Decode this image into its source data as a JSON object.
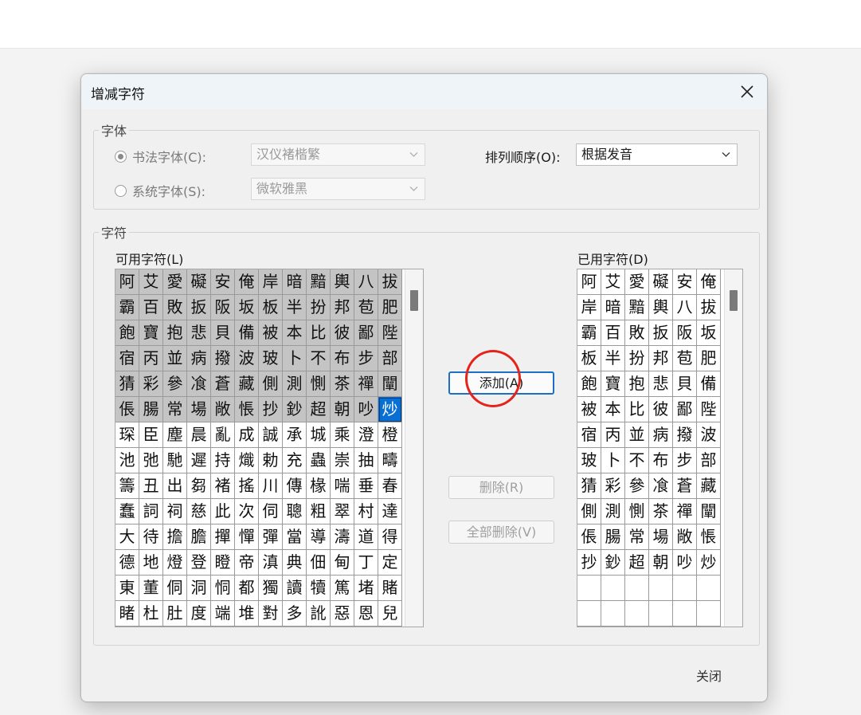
{
  "dialog": {
    "title": "增减字符",
    "font_group": {
      "legend": "字体",
      "calligraphy_radio": "书法字体(C):",
      "calligraphy_value": "汉仪褚楷繁",
      "system_radio": "系统字体(S):",
      "system_value": "微软雅黑",
      "sort_label": "排列顺序(O):",
      "sort_value": "根据发音"
    },
    "char_group": {
      "legend": "字符",
      "available_label": "可用字符(L)",
      "used_label": "已用字符(D)",
      "available_rows": [
        "阿艾愛礙安俺岸暗黯輿八拔",
        "霸百敗扳阪坂板半扮邦苞肥",
        "飽寶抱悲貝備被本比彼鄙陛",
        "宿丙並病撥波玻卜不布步部",
        "猜彩參飡蒼藏側測惻茶禪闡",
        "倀腸常場敞悵抄鈔超朝吵炒",
        "琛臣塵晨亂成誠承城乘澄橙",
        "池弛馳遲持熾勅充蟲崇抽疇",
        "籌丑出芻褚搖川傳椽喘垂春",
        "蠢詞祠慈此次伺聰粗翠村達",
        "大待擔膽撣憚彈當導濤道得",
        "德地燈登瞪帝滇典佃甸丁定",
        "東董侗洞恫都獨讀犢篤堵賭",
        "睹杜肚度端堆對多訛惡恩兒"
      ],
      "used_rows": [
        "阿艾愛礙安俺",
        "岸暗黯輿八拔",
        "霸百敗扳阪坂",
        "板半扮邦苞肥",
        "飽寶抱悲貝備",
        "被本比彼鄙陛",
        "宿丙並病撥波",
        "玻卜不布步部",
        "猜彩參飡蒼藏",
        "側測惻茶禪闡",
        "倀腸常場敞悵",
        "抄鈔超朝吵炒",
        "",
        ""
      ],
      "used_count_in_available": 71,
      "selected_index": 71
    },
    "buttons": {
      "add": "添加(A)",
      "delete": "删除(R)",
      "delete_all": "全部删除(V)",
      "close": "关闭"
    }
  },
  "icons": {
    "close": "close-icon",
    "dropdown": "chevron-down-icon"
  },
  "colors": {
    "selection": "#0a6fd3",
    "used_cell": "#c4c4c4",
    "highlight_ring": "#e4231a"
  }
}
